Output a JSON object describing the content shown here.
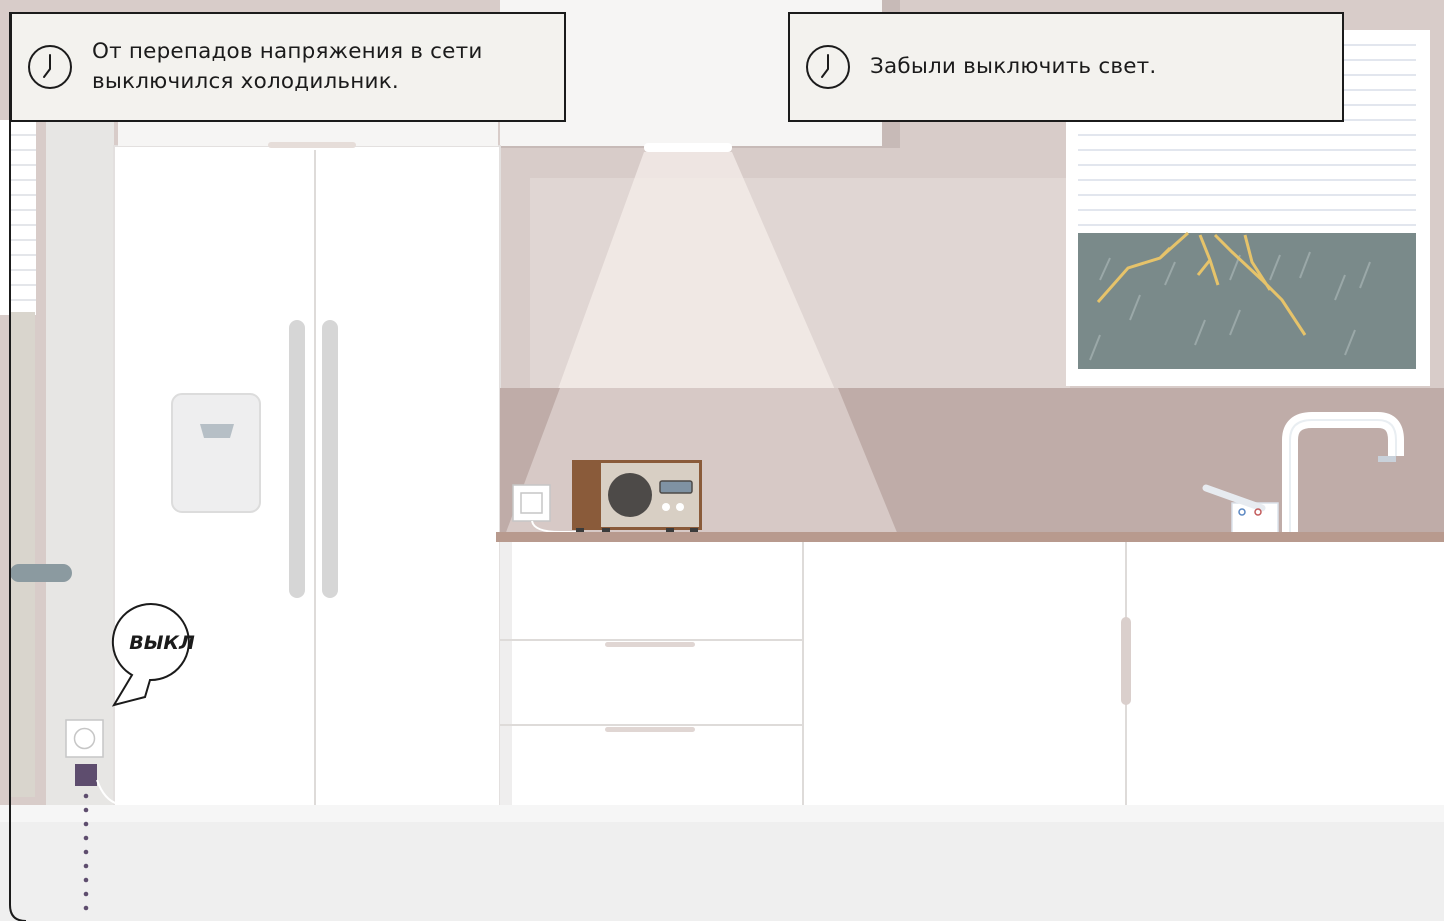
{
  "notifications": [
    {
      "icon": "clock-icon",
      "text": "От перепадов напряжения в сети\nвыключился холодильник."
    },
    {
      "icon": "clock-icon",
      "text": "Забыли выключить свет."
    }
  ],
  "outlet_bubble": {
    "label": "ВЫКЛ"
  },
  "colors": {
    "wall": "#d8ccc9",
    "backsplash": "#bfaca8",
    "countertop": "#b89a8e",
    "storm_sky": "#7a8a8a",
    "lightning": "#e6c36a",
    "smart_plug": "#5e4d6e",
    "panel_bg": "#f3f2ee",
    "outline": "#1b1b1b"
  }
}
